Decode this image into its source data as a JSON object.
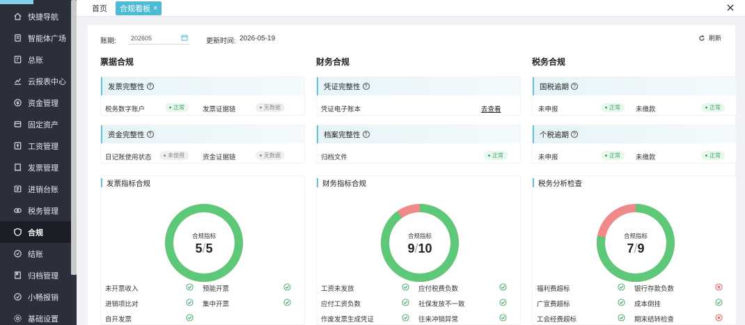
{
  "sidebar": {
    "items": [
      {
        "label": "快捷导航",
        "icon": "home-icon"
      },
      {
        "label": "智能体广场",
        "icon": "book-icon"
      },
      {
        "label": "总账",
        "icon": "ledger-icon"
      },
      {
        "label": "云报表中心",
        "icon": "chart-icon"
      },
      {
        "label": "资金管理",
        "icon": "money-icon"
      },
      {
        "label": "固定资产",
        "icon": "asset-icon"
      },
      {
        "label": "工资管理",
        "icon": "salary-icon"
      },
      {
        "label": "发票管理",
        "icon": "invoice-icon"
      },
      {
        "label": "进销台账",
        "icon": "trade-icon"
      },
      {
        "label": "税务管理",
        "icon": "tax-icon"
      },
      {
        "label": "合规",
        "icon": "shield-icon",
        "active": true
      },
      {
        "label": "结账",
        "icon": "checkout-icon"
      },
      {
        "label": "归档管理",
        "icon": "archive-icon"
      },
      {
        "label": "小畅报销",
        "icon": "reimburse-icon"
      },
      {
        "label": "基础设置",
        "icon": "gear-icon"
      }
    ]
  },
  "tabs": {
    "home": "首页",
    "current": "合规看板",
    "close_glyph": "×"
  },
  "filter": {
    "period_label": "账期:",
    "period_value": "202605",
    "update_label": "更新时间:",
    "update_value": "2026-05-19",
    "refresh_label": "刷新"
  },
  "columns": {
    "invoice": "票据合规",
    "finance": "财务合规",
    "tax": "税务合规"
  },
  "cards": {
    "invoice_integrity": {
      "title": "发票完整性",
      "r1": "税务数字账户",
      "b1": "正常",
      "r2": "发票证据链",
      "b2": "无数据"
    },
    "fund_integrity": {
      "title": "资金完整性",
      "r1": "日记账使用状态",
      "b1": "未使用",
      "r2": "资金证据链",
      "b2": "无数据"
    },
    "voucher_integrity": {
      "title": "凭证完整性",
      "r1": "凭证电子账本",
      "link": "去查看"
    },
    "archive_integrity": {
      "title": "档案完整性",
      "r1": "归档文件",
      "b1": "正常"
    },
    "national_tax": {
      "title": "国税逾期",
      "r1": "未申报",
      "b1": "正常",
      "r2": "未缴款",
      "b2": "正常"
    },
    "personal_tax": {
      "title": "个税逾期",
      "r1": "未申报",
      "b1": "正常",
      "r2": "未缴款",
      "b2": "正常"
    }
  },
  "indicators": {
    "invoice": {
      "title": "发票指标合规",
      "caption": "合规指标",
      "passed": 5,
      "total": 5,
      "items": [
        {
          "label": "未开票收入",
          "status": "ok"
        },
        {
          "label": "预能开票",
          "status": "ok"
        },
        {
          "label": "进销项比对",
          "status": "ok"
        },
        {
          "label": "集中开票",
          "status": "ok"
        },
        {
          "label": "自开发票",
          "status": "ok"
        }
      ]
    },
    "finance": {
      "title": "财务指标合规",
      "caption": "合规指标",
      "passed": 9,
      "total": 10,
      "items": [
        {
          "label": "工资未发放",
          "status": "ok"
        },
        {
          "label": "应付税费负数",
          "status": "ok"
        },
        {
          "label": "应付工资负数",
          "status": "ok"
        },
        {
          "label": "社保发放不一致",
          "status": "ok"
        },
        {
          "label": "作废发票生成凭证",
          "status": "ok"
        },
        {
          "label": "往来冲销异常",
          "status": "ok"
        }
      ]
    },
    "tax": {
      "title": "税务分析检查",
      "caption": "合规指标",
      "passed": 7,
      "total": 9,
      "items": [
        {
          "label": "福利费超标",
          "status": "ok"
        },
        {
          "label": "银行存款负数",
          "status": "fail"
        },
        {
          "label": "广宣费超标",
          "status": "ok"
        },
        {
          "label": "成本倒挂",
          "status": "ok"
        },
        {
          "label": "工会经费超标",
          "status": "ok"
        },
        {
          "label": "期末结转检查",
          "status": "fail"
        }
      ]
    }
  },
  "colors": {
    "accent": "#4dbbd6",
    "ok": "#5cc878",
    "fail": "#f08a8a",
    "sidebar": "#2b2f3a"
  }
}
